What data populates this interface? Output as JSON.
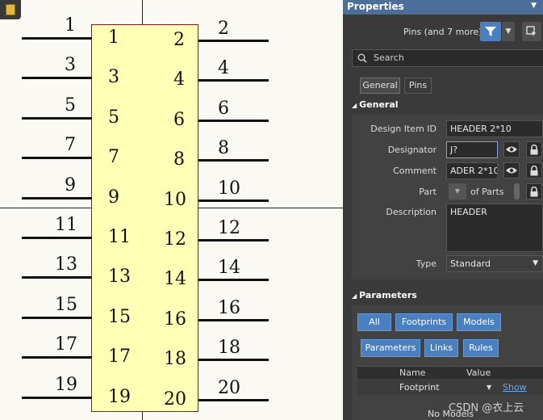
{
  "schematic": {
    "left_pins": [
      "1",
      "3",
      "5",
      "7",
      "9",
      "11",
      "13",
      "15",
      "17",
      "19"
    ],
    "right_pins": [
      "2",
      "4",
      "6",
      "8",
      "10",
      "12",
      "14",
      "16",
      "18",
      "20"
    ]
  },
  "panel": {
    "title": "Properties",
    "filter_text": "Pins (and 7 more)",
    "search_placeholder": "Search",
    "tabs": [
      "General",
      "Pins"
    ],
    "general": {
      "section_label": "General",
      "design_item_id_label": "Design Item ID",
      "design_item_id_value": "HEADER 2*10",
      "designator_label": "Designator",
      "designator_value": "J?",
      "comment_label": "Comment",
      "comment_value": "ADER 2*10",
      "part_label": "Part",
      "of_parts_label": "of Parts",
      "description_label": "Description",
      "description_value": "HEADER",
      "type_label": "Type",
      "type_value": "Standard"
    },
    "parameters": {
      "section_label": "Parameters",
      "buttons_row1": [
        "All",
        "Footprints",
        "Models"
      ],
      "buttons_row2": [
        "Parameters",
        "Links",
        "Rules"
      ],
      "col_name": "Name",
      "col_value": "Value",
      "row_name": "Footprint",
      "row_link": "Show",
      "no_models": "No Models"
    }
  },
  "watermark": "CSDN @衣上云"
}
